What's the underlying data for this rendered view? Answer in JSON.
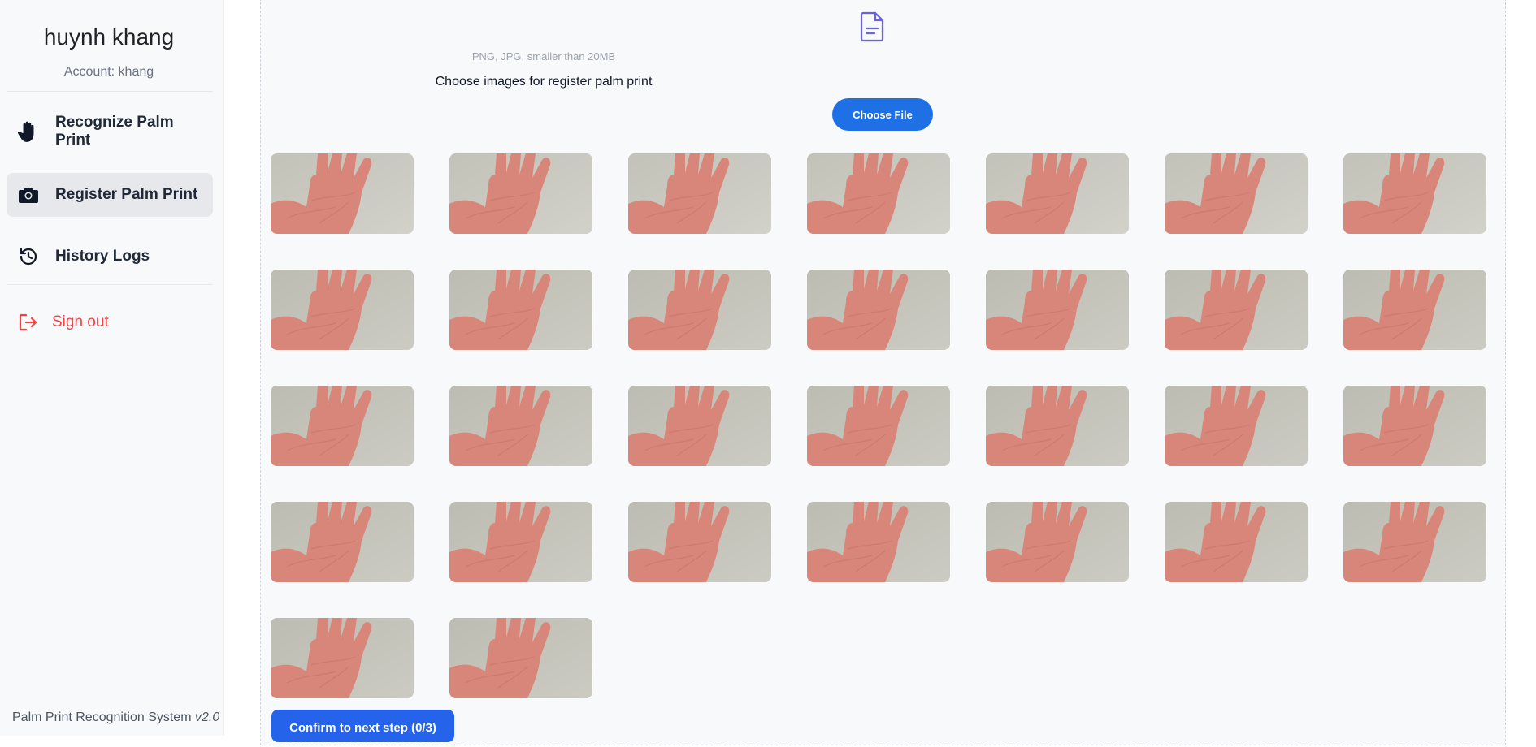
{
  "user": {
    "name": "huynh khang",
    "account": "Account: khang"
  },
  "nav": {
    "recognize_label": "Recognize Palm Print",
    "register_label": "Register Palm Print",
    "history_label": "History Logs",
    "signout_label": "Sign out"
  },
  "footer": {
    "app_name": "Palm Print Recognition System",
    "version": "v2.0"
  },
  "upload": {
    "hint": "PNG, JPG, smaller than 20MB",
    "title": "Choose images for register palm print",
    "choose_label": "Choose File"
  },
  "confirm": {
    "label": "Confirm to next step (0/3)"
  },
  "images": {
    "count": 30
  },
  "colors": {
    "accent": "#1f6fe5",
    "signout": "#ef4444",
    "active_bg": "#e7e8ec"
  }
}
